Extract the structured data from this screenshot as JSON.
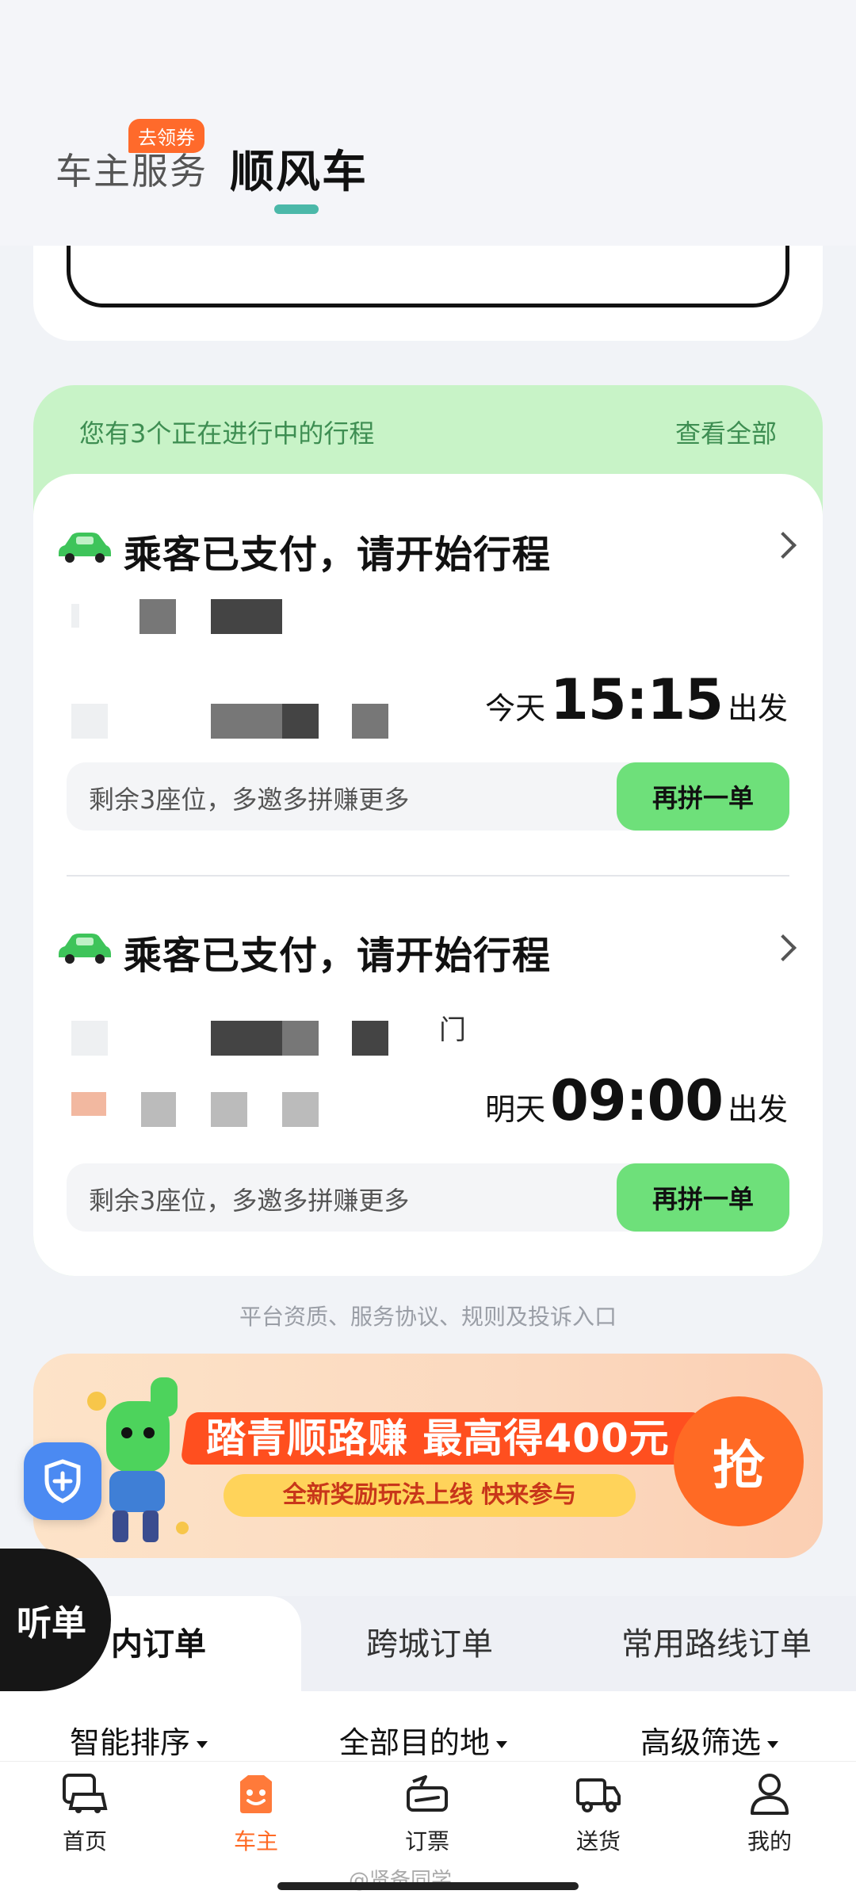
{
  "header": {
    "tab_owner_service": "车主服务",
    "coupon_badge": "去领券",
    "tab_ride": "顺风车"
  },
  "trips": {
    "notice": "您有3个正在进行中的行程",
    "view_all": "查看全部",
    "items": [
      {
        "status": "乘客已支付，请开始行程",
        "day": "今天",
        "time": "15:15",
        "suffix": "出发",
        "seats_text": "剩余3座位，多邀多拼赚更多",
        "again_label": "再拼一单"
      },
      {
        "status": "乘客已支付，请开始行程",
        "door_char": "门",
        "day": "明天",
        "time": "09:00",
        "suffix": "出发",
        "seats_text": "剩余3座位，多邀多拼赚更多",
        "again_label": "再拼一单"
      }
    ]
  },
  "platform_link": "平台资质、服务协议、规则及投诉入口",
  "banner": {
    "title": "踏青顺路赚 最高得400元",
    "subtitle": "全新奖励玩法上线 快来参与",
    "grab": "抢"
  },
  "listen_button": "听单",
  "order_tabs": [
    "内订单",
    "跨城订单",
    "常用路线订单"
  ],
  "filters": [
    "智能排序",
    "全部目的地",
    "高级筛选"
  ],
  "bottom_nav": [
    {
      "label": "首页",
      "icon": "car-home-icon"
    },
    {
      "label": "车主",
      "icon": "driver-icon",
      "active": true
    },
    {
      "label": "订票",
      "icon": "ticket-icon"
    },
    {
      "label": "送货",
      "icon": "truck-icon"
    },
    {
      "label": "我的",
      "icon": "person-icon"
    }
  ],
  "watermark": "@贤备同学",
  "colors": {
    "accent_green": "#6ee07a",
    "notice_green": "#3e8e52",
    "active_orange": "#ff6a24",
    "tab_underline": "#4bb8a9"
  }
}
